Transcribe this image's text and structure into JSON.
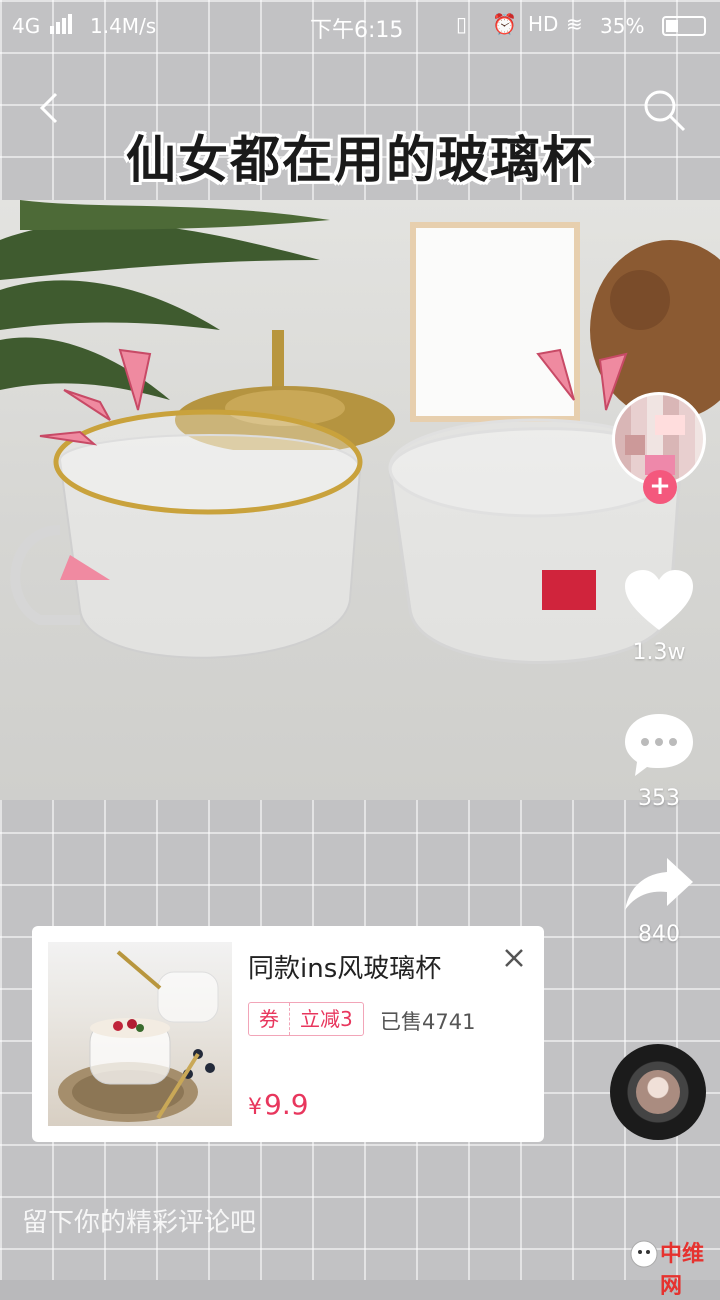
{
  "status_bar": {
    "network": "4G",
    "speed": "1.4M/s",
    "time": "下午6:15",
    "hd": "HD",
    "battery": "35%"
  },
  "video": {
    "title_overlay": "仙女都在用的玻璃杯"
  },
  "actions": {
    "like_count": "1.3w",
    "comment_count": "353",
    "share_count": "840"
  },
  "product": {
    "name": "同款ins风玻璃杯",
    "coupon_tag": "券",
    "coupon_discount": "立减3",
    "sold": "已售4741",
    "price_symbol": "¥",
    "price": "9.9"
  },
  "comment_input": {
    "placeholder": "留下你的精彩评论吧"
  },
  "watermark": {
    "text": "中维网"
  },
  "colors": {
    "accent": "#e8365d",
    "follow_plus": "#f4587d"
  }
}
